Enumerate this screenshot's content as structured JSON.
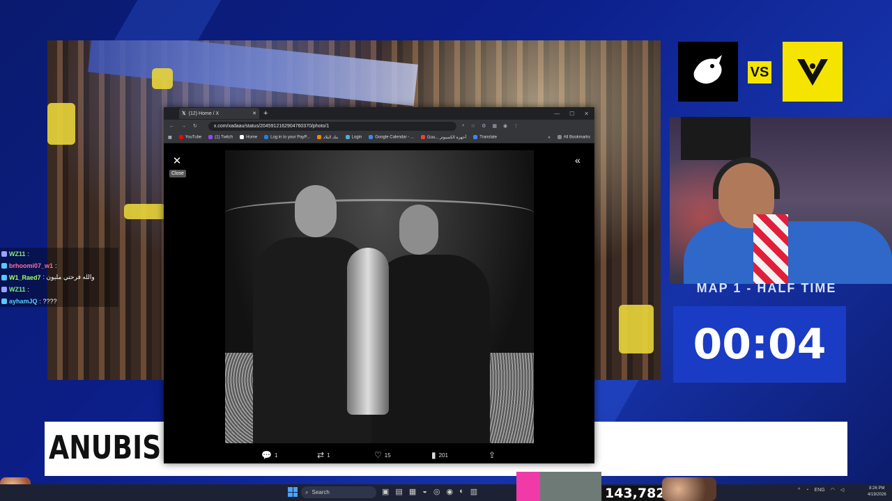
{
  "overlay": {
    "vs_label": "VS",
    "map_label": "MAP 1 - HALF TIME",
    "timer": "00:04",
    "ticker_text": "ANUBIS T",
    "viewer_count": "143,782"
  },
  "chat": [
    {
      "user": "WZ11",
      "message": ":",
      "color": "#7cf07c",
      "badge": "#9aa3ff"
    },
    {
      "user": "brhoomi07_w1",
      "message": ":",
      "color": "#ff6fa0",
      "badge": "#5ac8ff"
    },
    {
      "user": "W1_Raed7",
      "message": ": والله فرحتي مليون",
      "color": "#a6ff6a",
      "badge": "#5ac8ff"
    },
    {
      "user": "WZ11",
      "message": ":",
      "color": "#7cf07c",
      "badge": "#9aa3ff"
    },
    {
      "user": "ayhamJQ",
      "message": ": ????",
      "color": "#5ad1ff",
      "badge": "#5ac8ff"
    }
  ],
  "browser": {
    "tab_title": "(12) Home / X",
    "url": "x.com/xadaau/status/2045912162904760370/photo/1",
    "bookmarks": [
      "YouTube",
      "(1) Twitch",
      "Home",
      "Log in to your PayP...",
      "بنك البلاد",
      "Login",
      "Google Calendar - ...",
      "Goo... أجهزة الكمبيوتر",
      "Translate"
    ],
    "all_bookmarks": "All Bookmarks",
    "close_tooltip": "Close",
    "actions": {
      "replies": "1",
      "reposts": "1",
      "likes": "15",
      "views": "201"
    }
  },
  "taskbar": {
    "search_placeholder": "Search",
    "lang": "ENG",
    "time": "8:26 PM",
    "date": "4/19/2026"
  },
  "colors": {
    "accent_blue": "#1a3bc4",
    "team_yellow": "#f5e400",
    "background": "#0c1f8a"
  }
}
